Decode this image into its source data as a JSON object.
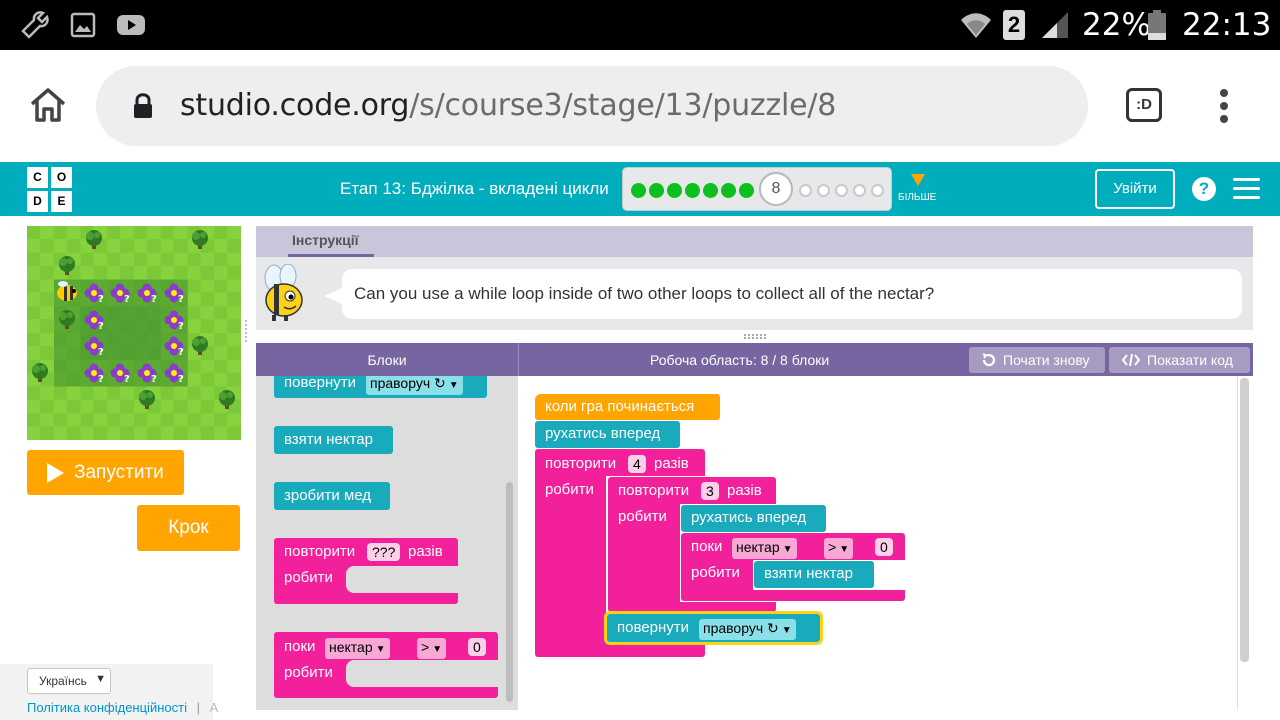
{
  "status_bar": {
    "battery": "22%",
    "time": "22:13",
    "sim_badge": "2",
    "icons": [
      "wrench-icon",
      "image-icon",
      "youtube-icon",
      "wifi-icon",
      "signal-icon",
      "battery-icon"
    ]
  },
  "browser": {
    "url_domain": "studio.code.org",
    "url_path": "/s/course3/stage/13/puzzle/8",
    "tab_badge": ":D"
  },
  "header": {
    "logo_letters": [
      "C",
      "O",
      "D",
      "E"
    ],
    "stage_title": "Етап 13: Бджілка - вкладені цикли",
    "current_puzzle": "8",
    "completed_count": 7,
    "remaining_count": 5,
    "more_label": "БІЛЬШЕ",
    "signin_label": "Увійти",
    "help_label": "?"
  },
  "controls": {
    "run_label": "Запустити",
    "step_label": "Крок"
  },
  "footer": {
    "language": "Українсь",
    "privacy_link": "Політика конфіденційності",
    "separator": "|",
    "cut_text": "А"
  },
  "instructions": {
    "tab_label": "Інструкції",
    "text": "Can you use a while loop inside of two other loops to collect all of the nectar?"
  },
  "workspace_header": {
    "toolbox_title": "Блоки",
    "workspace_title": "Робоча область: 8 / 8 блоки",
    "reset_label": "Почати знову",
    "show_code_label": "Показати код"
  },
  "toolbox": {
    "turn_label": "повернути",
    "turn_direction": "праворуч ↻",
    "get_nectar": "взяти нектар",
    "make_honey": "зробити мед",
    "repeat_label": "повторити",
    "repeat_count": "???",
    "times_label": "разів",
    "do_label": "робити",
    "while_label": "поки",
    "nectar_option": "нектар",
    "compare_op": ">",
    "compare_value": "0"
  },
  "workspace": {
    "when_run": "коли гра починається",
    "move_forward": "рухатись вперед",
    "repeat_label": "повторити",
    "outer_count": "4",
    "inner_count": "3",
    "times_label": "разів",
    "do_label": "робити",
    "while_label": "поки",
    "nectar_option": "нектар",
    "compare_op": ">",
    "compare_value": "0",
    "get_nectar": "взяти нектар",
    "turn_label": "повернути",
    "turn_direction": "праворуч ↻"
  }
}
